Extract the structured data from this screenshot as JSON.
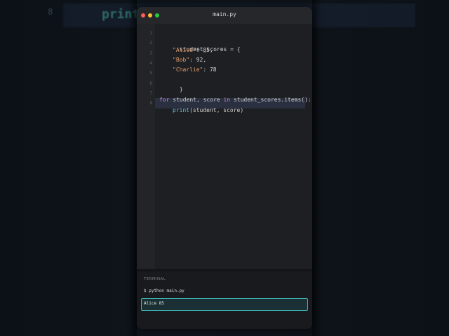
{
  "background": {
    "line_number": "8",
    "code_fragment": "print"
  },
  "window": {
    "title": "main.py",
    "controls": {
      "close_color": "#ff5f56",
      "minimize_color": "#ffbd2e",
      "maximize_color": "#27c93f"
    }
  },
  "editor": {
    "line_numbers": [
      "1",
      "2",
      "3",
      "4",
      "5",
      "6",
      "7",
      "8"
    ],
    "lines": {
      "l1": "student_scores = {",
      "l2_key": "\"Alice\"",
      "l2_rest": ": 85,",
      "l3_key": "\"Bob\"",
      "l3_rest": ": 92,",
      "l4_key": "\"Charlie\"",
      "l4_rest": ": 78",
      "l5": "}",
      "l7_for": "for",
      "l7_mid": " student, score ",
      "l7_in": "in",
      "l7_rest": " student_scores.items():",
      "l8_fn": "print",
      "l8_rest": "(student, score)"
    },
    "highlighted_line": "8",
    "colors": {
      "string": "#e29a6b",
      "keyword": "#c587d4",
      "function": "#69c0d9"
    }
  },
  "terminal": {
    "label": "TERMINAL",
    "command": "$ python main.py",
    "output": "Alice 85"
  }
}
